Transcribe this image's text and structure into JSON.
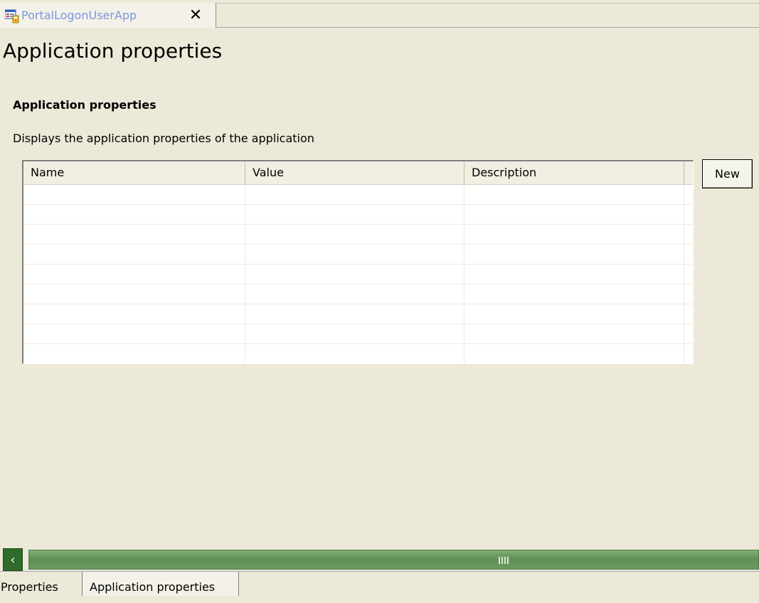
{
  "editor_tab": {
    "label": "PortalLogonUserApp",
    "icon": "application-icon",
    "close_label": "✕"
  },
  "page": {
    "title": "Application properties"
  },
  "section": {
    "title": "Application properties",
    "description": "Displays the application properties of the application"
  },
  "table": {
    "columns": [
      "Name",
      "Value",
      "Description"
    ],
    "rows": [
      [
        "",
        "",
        ""
      ],
      [
        "",
        "",
        ""
      ],
      [
        "",
        "",
        ""
      ],
      [
        "",
        "",
        ""
      ],
      [
        "",
        "",
        ""
      ],
      [
        "",
        "",
        ""
      ],
      [
        "",
        "",
        ""
      ],
      [
        "",
        "",
        ""
      ],
      [
        "",
        "",
        ""
      ]
    ]
  },
  "buttons": {
    "new_label": "New"
  },
  "scrollbar": {
    "left_arrow": "‹",
    "thumb_color": "#6A9A5F"
  },
  "bottom_tabs": [
    {
      "label": "Properties",
      "selected": false
    },
    {
      "label": "Application properties",
      "selected": true
    }
  ]
}
